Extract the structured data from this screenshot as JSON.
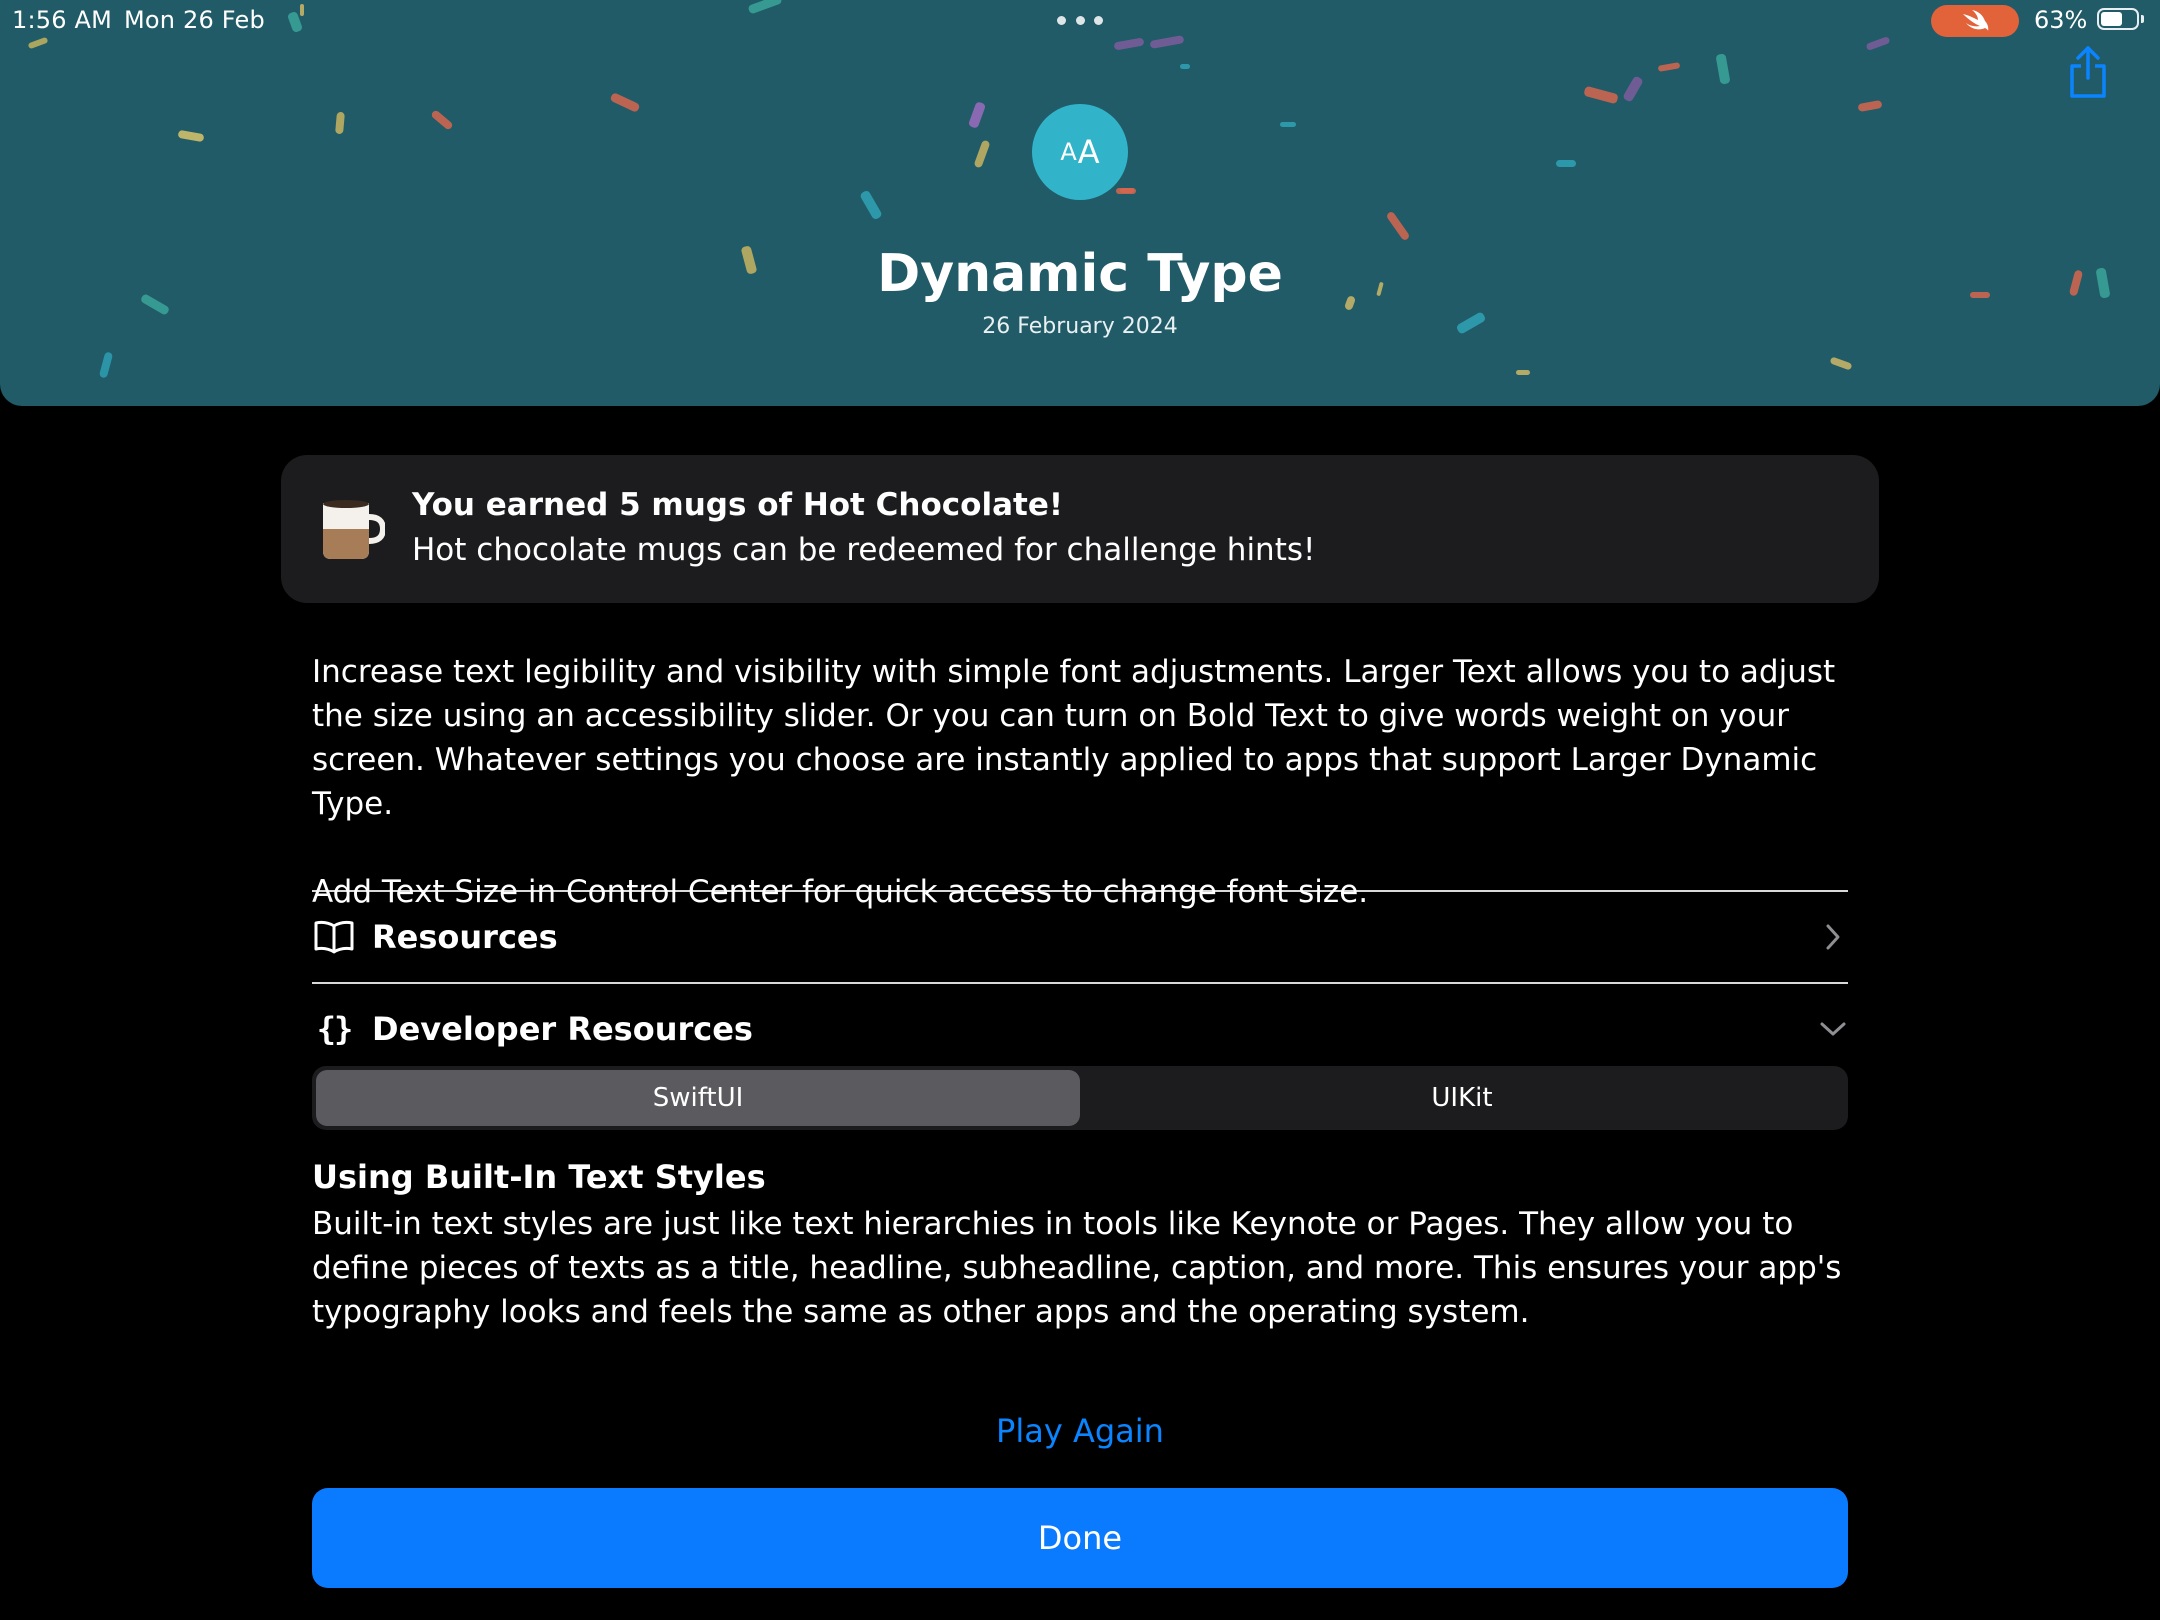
{
  "status_bar": {
    "time": "1:56 AM",
    "date": "Mon 26 Feb",
    "battery_percent": "63%",
    "battery_level": 0.63,
    "swift_indicator_icon": "swift-icon"
  },
  "header": {
    "badge_small": "A",
    "badge_large": "A",
    "title": "Dynamic Type",
    "date": "26 February 2024",
    "share_icon": "share-icon",
    "background_color": "#215b67"
  },
  "reward": {
    "icon": "hot-chocolate-mug-icon",
    "title": "You earned 5 mugs of Hot Chocolate!",
    "subtitle": "Hot chocolate mugs can be redeemed for challenge hints!"
  },
  "description": {
    "paragraph": "Increase text legibility and visibility with simple font adjustments. Larger Text allows you to adjust the size using an accessibility slider. Or you can turn on Bold Text to give words weight on your screen. Whatever settings you choose are instantly applied to apps that support Larger Dynamic Type.",
    "tip": "Add Text Size in Control Center for quick access to change font size."
  },
  "resources_row": {
    "icon": "book-icon",
    "label": "Resources",
    "chevron": "chevron-right-icon"
  },
  "developer_row": {
    "icon": "curly-braces-icon",
    "label": "Developer Resources",
    "chevron": "chevron-down-icon",
    "expanded": true
  },
  "segmented": {
    "options": [
      "SwiftUI",
      "UIKit"
    ],
    "selected": "SwiftUI"
  },
  "text_styles": {
    "title": "Using Built-In Text Styles",
    "body": "Built-in text styles are just like text hierarchies in tools like Keynote or Pages. They allow you to define pieces of texts as a title, headline, subheadline, caption, and more. This ensures your app's typography looks and feels the same as other apps and the operating system."
  },
  "actions": {
    "play_again": "Play Again",
    "done": "Done"
  },
  "colors": {
    "accent": "#0a84ff",
    "card": "#1c1c1e",
    "badge": "#31b4c9",
    "swift_pill": "#e2623a"
  }
}
